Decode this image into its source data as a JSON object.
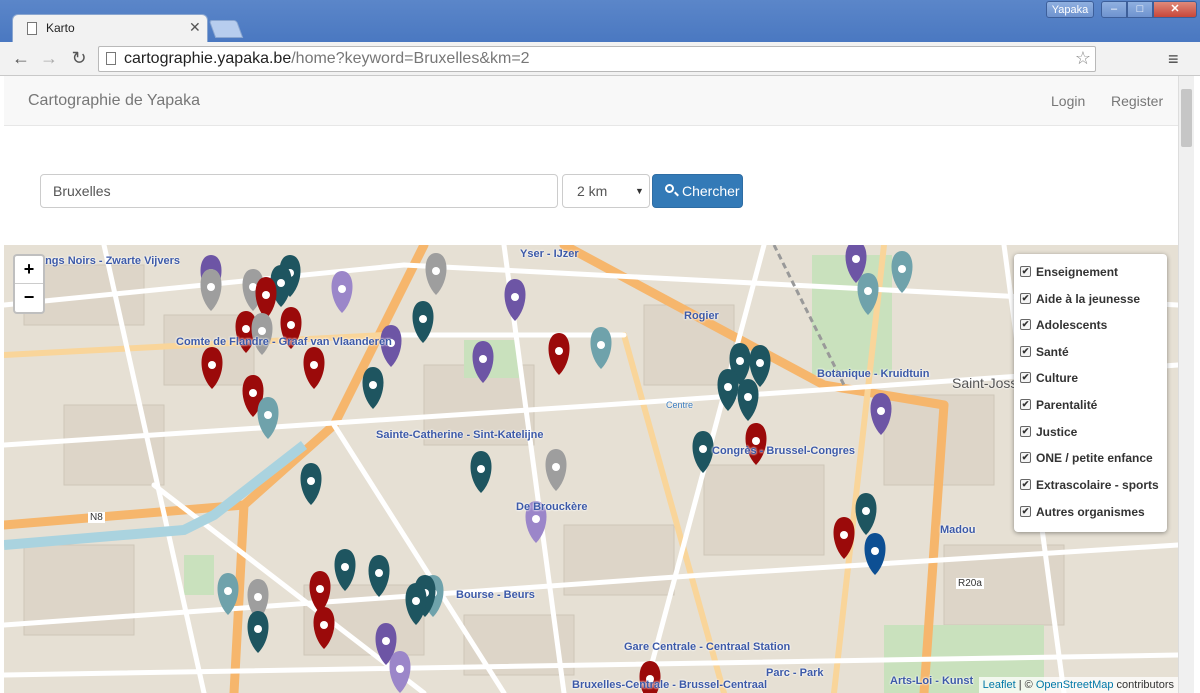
{
  "browser": {
    "tab_title": "Karto",
    "profile": "Yapaka",
    "url_host": "cartographie.yapaka.be",
    "url_path": "/home?keyword=Bruxelles&km=2"
  },
  "navbar": {
    "brand": "Cartographie de Yapaka",
    "login": "Login",
    "register": "Register"
  },
  "search": {
    "keyword": "Bruxelles",
    "distance": "2 km",
    "button": "Chercher"
  },
  "map": {
    "zoom_in": "+",
    "zoom_out": "−",
    "labels": [
      "Yser - IJzer",
      "Rogier",
      "Botanique - Kruidtuin",
      "Comte de Flandre - Graaf van Vlaanderen",
      "Sainte-Catherine - Sint-Katelijne",
      "Congrès - Brussel-Congres",
      "De Brouckère",
      "Madou",
      "Bourse - Beurs",
      "Gare Centrale - Centraal Station",
      "Parc - Park",
      "Bruxelles-Centrale - Brussel-Centraal",
      "Arts-Loi - Kunst",
      "Saint-Josse - Sint-Joost",
      "Étangs Noirs - Zwarte Vijvers",
      "Centre",
      "N8",
      "R20a"
    ],
    "legend": [
      "Enseignement",
      "Aide à la jeunesse",
      "Adolescents",
      "Santé",
      "Culture",
      "Parentalité",
      "Justice",
      "ONE / petite enfance",
      "Extrascolaire - sports",
      "Autres organismes"
    ],
    "attribution": {
      "leaflet": "Leaflet",
      "sep": " | © ",
      "osm": "OpenStreetMap",
      "tail": " contributors"
    },
    "marker_colors": {
      "teal": "#1e5560",
      "red": "#9b0a0a",
      "purple": "#6d55a5",
      "lightpurple": "#9b86c9",
      "grey": "#9e9e9e",
      "lightteal": "#6fa2ab",
      "blue": "#0d4f93"
    }
  }
}
